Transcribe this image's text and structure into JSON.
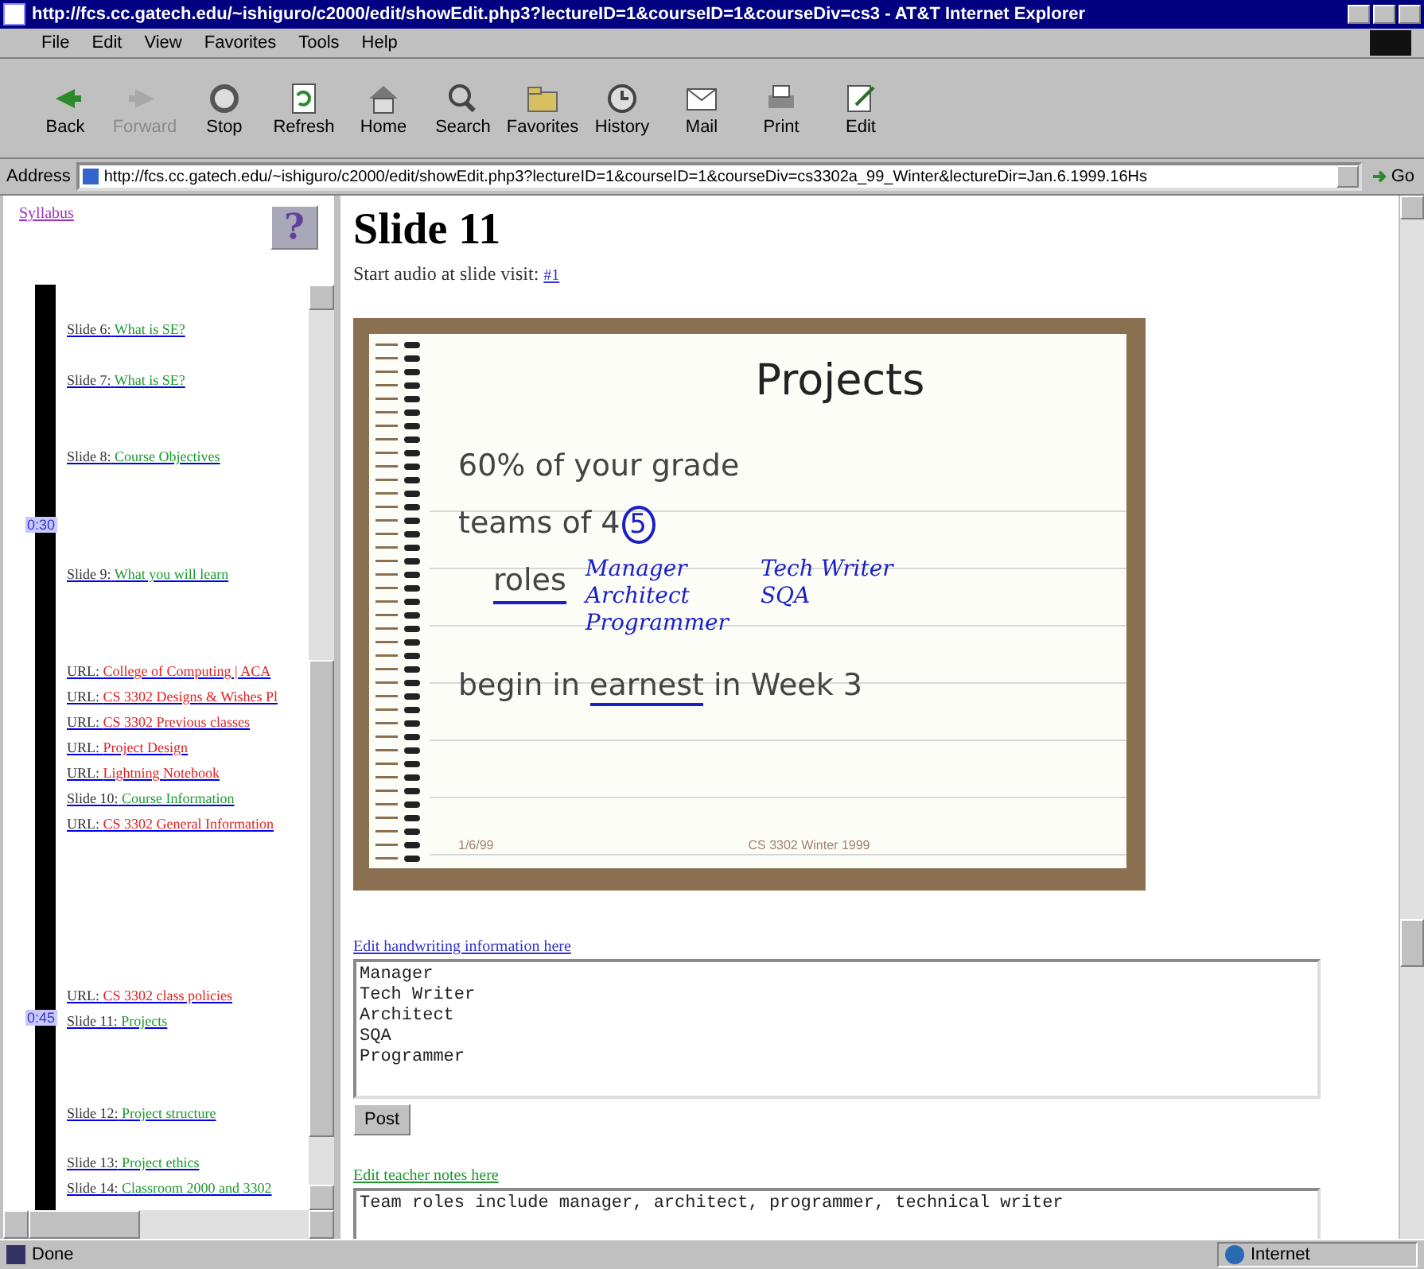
{
  "window": {
    "title": "http://fcs.cc.gatech.edu/~ishiguro/c2000/edit/showEdit.php3?lectureID=1&courseID=1&courseDiv=cs3 - AT&T Internet Explorer"
  },
  "menu": [
    "File",
    "Edit",
    "View",
    "Favorites",
    "Tools",
    "Help"
  ],
  "toolbar": [
    {
      "label": "Back",
      "disabled": false
    },
    {
      "label": "Forward",
      "disabled": true
    },
    {
      "label": "Stop",
      "disabled": false
    },
    {
      "label": "Refresh",
      "disabled": false
    },
    {
      "label": "Home",
      "disabled": false
    },
    {
      "label": "Search",
      "disabled": false
    },
    {
      "label": "Favorites",
      "disabled": false
    },
    {
      "label": "History",
      "disabled": false
    },
    {
      "label": "Mail",
      "disabled": false
    },
    {
      "label": "Print",
      "disabled": false
    },
    {
      "label": "Edit",
      "disabled": false
    }
  ],
  "address": {
    "label": "Address",
    "value": "http://fcs.cc.gatech.edu/~ishiguro/c2000/edit/showEdit.php3?lectureID=1&courseID=1&courseDiv=cs3302a_99_Winter&lectureDir=Jan.6.1999.16Hs",
    "go": "Go"
  },
  "sidebar": {
    "syllabus": "Syllabus",
    "help": "?",
    "items": [
      {
        "kind": "slide",
        "prefix": "Slide 6:",
        "title": "What is SE?"
      },
      {
        "kind": "slide",
        "prefix": "Slide 7:",
        "title": "What is SE?"
      },
      {
        "kind": "slide",
        "prefix": "Slide 8:",
        "title": "Course Objectives"
      },
      {
        "kind": "marker",
        "time": "0:30"
      },
      {
        "kind": "slide",
        "prefix": "Slide 9:",
        "title": "What you will learn"
      },
      {
        "kind": "url",
        "prefix": "URL:",
        "title": "College of Computing | ACA"
      },
      {
        "kind": "url",
        "prefix": "URL:",
        "title": "CS 3302 Designs & Wishes Pl"
      },
      {
        "kind": "url",
        "prefix": "URL:",
        "title": "CS 3302 Previous classes"
      },
      {
        "kind": "url",
        "prefix": "URL:",
        "title": "Project Design"
      },
      {
        "kind": "url",
        "prefix": "URL:",
        "title": "Lightning Notebook"
      },
      {
        "kind": "slide",
        "prefix": "Slide 10:",
        "title": "Course Information"
      },
      {
        "kind": "url",
        "prefix": "URL:",
        "title": "CS 3302 General Information"
      },
      {
        "kind": "url",
        "prefix": "URL:",
        "title": "CS 3302 class policies"
      },
      {
        "kind": "slide",
        "prefix": "Slide 11:",
        "title": "Projects",
        "time": "0:45"
      },
      {
        "kind": "slide",
        "prefix": "Slide 12:",
        "title": "Project structure"
      },
      {
        "kind": "slide",
        "prefix": "Slide 13:",
        "title": "Project ethics"
      },
      {
        "kind": "slide",
        "prefix": "Slide 14:",
        "title": "Classroom 2000 and 3302"
      }
    ]
  },
  "main": {
    "heading": "Slide 11",
    "audio_text": "Start audio at slide visit:",
    "audio_link": "#1",
    "slide": {
      "title": "Projects",
      "lines": [
        {
          "kind": "text",
          "text": "60% of your grade"
        },
        {
          "kind": "text",
          "text": "teams of 4",
          "ink": "5"
        },
        {
          "kind": "roles",
          "text": "roles",
          "ink_columns": [
            [
              "Manager",
              "Architect",
              "Programmer"
            ],
            [
              "Tech Writer",
              "SQA"
            ]
          ]
        },
        {
          "kind": "underlined",
          "before": "begin in",
          "ink_underlined": "earnest",
          "after": "in Week 3"
        }
      ],
      "footer_date": "1/6/99",
      "footer_course": "CS 3302 Winter 1999"
    },
    "handwriting_link": "Edit handwriting information here",
    "handwriting_value": "Manager\nTech Writer\nArchitect\nSQA\nProgrammer",
    "post_button": "Post",
    "notes_link": "Edit teacher notes here",
    "notes_value": "Team roles include manager, architect, programmer, technical writer"
  },
  "status_bar": {
    "text": "Done",
    "zone": "Internet"
  }
}
